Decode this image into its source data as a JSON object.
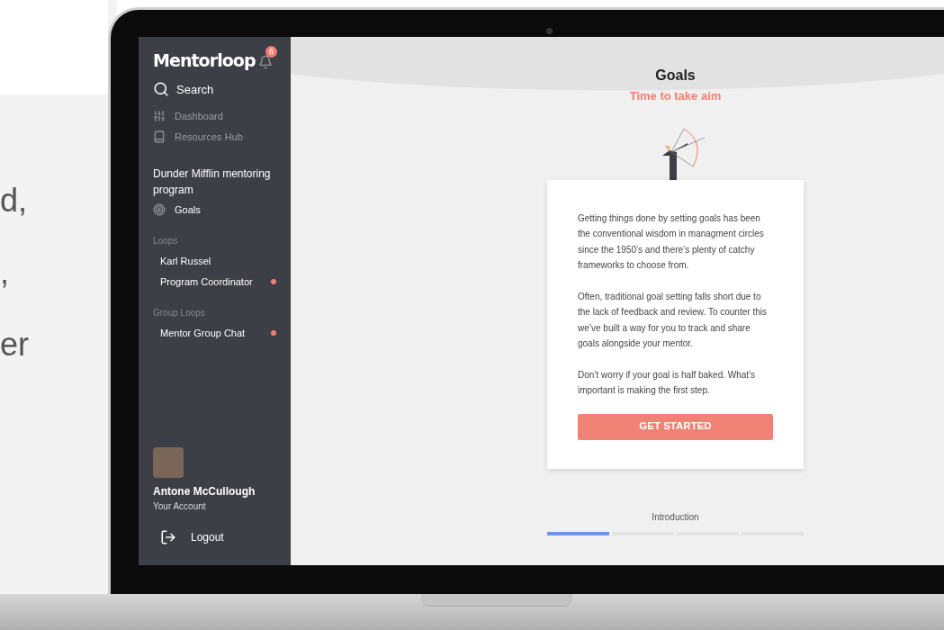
{
  "backdrop_text": [
    "d,",
    ",",
    "er"
  ],
  "sidebar": {
    "logo": "Mentorloop",
    "notification_count": "6",
    "search": {
      "label": "Search"
    },
    "nav": [
      {
        "label": "Dashboard",
        "selected": false
      },
      {
        "label": "Resources Hub",
        "selected": false
      }
    ],
    "program": {
      "title": "Dunder Mifflin mentoring program",
      "items": [
        {
          "label": "Goals",
          "selected": true
        }
      ]
    },
    "sections": [
      {
        "heading": "Loops",
        "items": [
          {
            "label": "Karl Russel",
            "unread": false
          },
          {
            "label": "Program Coordinator",
            "unread": true
          }
        ]
      },
      {
        "heading": "Group Loops",
        "items": [
          {
            "label": "Mentor Group Chat",
            "unread": true
          }
        ]
      }
    ],
    "account": {
      "name": "Antone McCullough",
      "subtitle": "Your Account"
    },
    "logout": "Logout"
  },
  "main": {
    "title": "Goals",
    "subtitle": "Time to take aim",
    "paragraphs": [
      "Getting things done by setting goals has been the conventional wisdom in managment circles since the 1950’s and there’s plenty of catchy frameworks to choose from.",
      "Often, traditional goal setting falls short due to the lack of feedback and review. To counter this we’ve built a way for you to track and share goals alongside your mentor.",
      "Don’t worry if your goal is half baked. What’s important is making the first step."
    ],
    "button": "GET STARTED",
    "progress": {
      "label": "Introduction",
      "steps": [
        {
          "done": true
        },
        {
          "done": false
        },
        {
          "done": false
        },
        {
          "done": false
        }
      ]
    }
  }
}
